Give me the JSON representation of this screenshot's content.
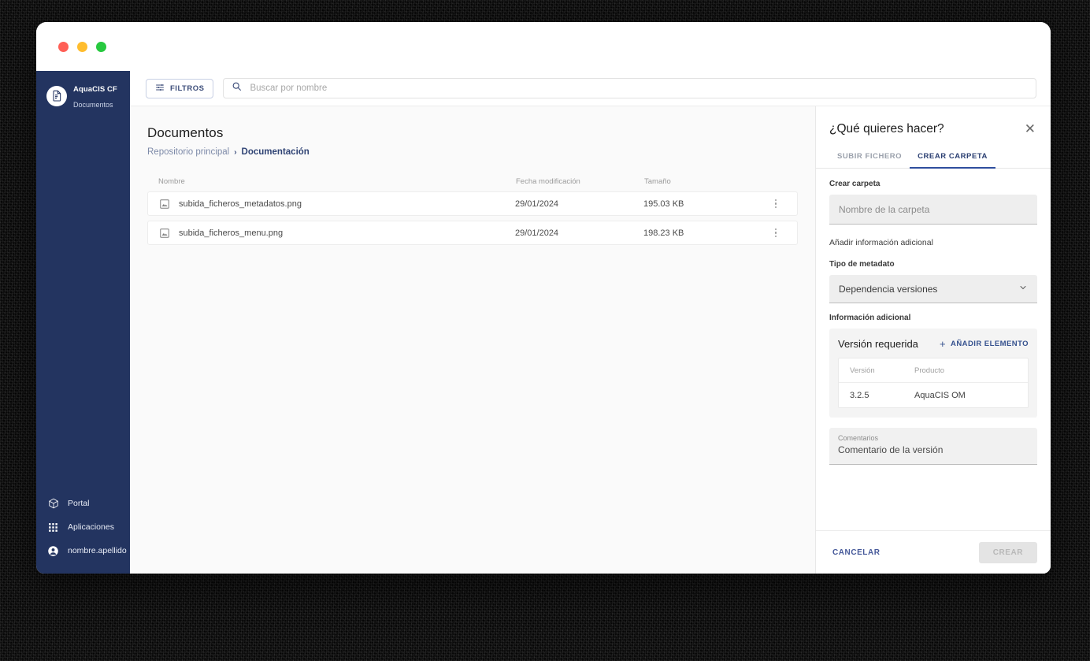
{
  "window": {
    "traffic_lights": [
      "close",
      "minimize",
      "zoom"
    ]
  },
  "sidebar": {
    "brand": {
      "icon": "document-app-icon",
      "title": "AquaCIS CF",
      "subtitle": "Documentos"
    },
    "bottom_items": [
      {
        "icon": "cube-icon",
        "label": "Portal"
      },
      {
        "icon": "grid-apps-icon",
        "label": "Aplicaciones"
      },
      {
        "icon": "user-account-icon",
        "label": "nombre.apellido"
      }
    ]
  },
  "toolbar": {
    "filters_label": "FILTROS",
    "filters_icon": "sliders-icon",
    "search_icon": "search-icon",
    "search_placeholder": "Buscar por nombre",
    "search_value": ""
  },
  "main": {
    "page_title": "Documentos",
    "breadcrumb": {
      "root": "Repositorio principal",
      "separator": "›",
      "current": "Documentación"
    },
    "table": {
      "columns": [
        "Nombre",
        "Fecha modificación",
        "Tamaño"
      ],
      "rows": [
        {
          "icon": "image-file-icon",
          "name": "subida_ficheros_metadatos.png",
          "modified": "29/01/2024",
          "size": "195.03 KB",
          "menu_icon": "kebab-menu-icon"
        },
        {
          "icon": "image-file-icon",
          "name": "subida_ficheros_menu.png",
          "modified": "29/01/2024",
          "size": "198.23 KB",
          "menu_icon": "kebab-menu-icon"
        }
      ]
    }
  },
  "drawer": {
    "title": "¿Qué quieres hacer?",
    "close_icon": "close-icon",
    "tabs": [
      {
        "label": "SUBIR FICHERO",
        "active": false
      },
      {
        "label": "CREAR CARPETA",
        "active": true
      }
    ],
    "create_folder": {
      "label": "Crear carpeta",
      "input_placeholder": "Nombre de la carpeta",
      "input_value": ""
    },
    "additional_info_label": "Añadir información adicional",
    "metadata_type": {
      "label": "Tipo de metadato",
      "selected": "Dependencia versiones",
      "chevron_icon": "chevron-down-icon"
    },
    "additional_info_section_label": "Información adicional",
    "version_card": {
      "title": "Versión requerida",
      "add_label": "AÑADIR ELEMENTO",
      "add_icon": "plus-icon",
      "columns": [
        "Versión",
        "Producto"
      ],
      "rows": [
        {
          "version": "3.2.5",
          "product": "AquaCIS OM"
        }
      ]
    },
    "comments": {
      "label": "Comentarios",
      "value": "Comentario de la versión"
    },
    "footer": {
      "cancel_label": "CANCELAR",
      "create_label": "CREAR"
    }
  },
  "colors": {
    "sidebar_navy": "#233460",
    "accent_blue": "#2f4e9e",
    "link_blue": "#36528f",
    "traffic_red": "#ff5f56",
    "traffic_yellow": "#ffbd2e",
    "traffic_green": "#27c93f"
  }
}
